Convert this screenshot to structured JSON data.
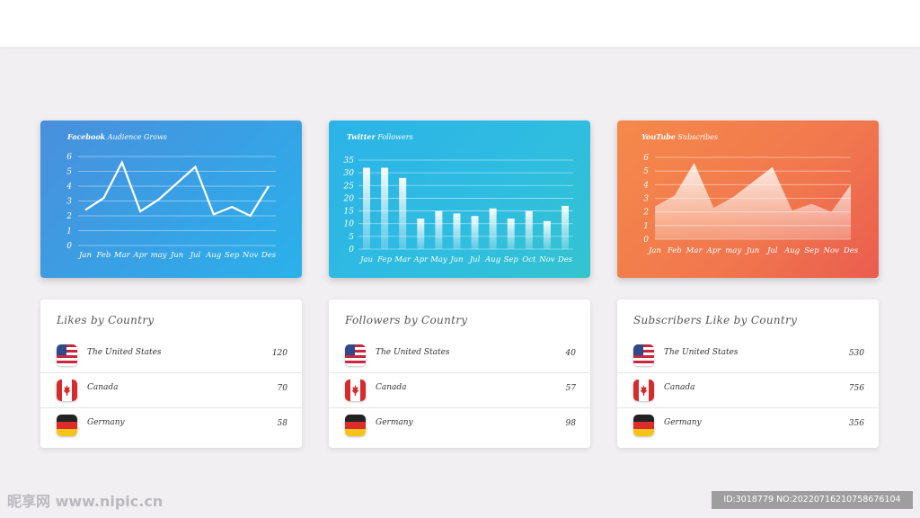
{
  "chart_data": [
    {
      "type": "line",
      "title_brand": "Facebook",
      "title_rest": " Audience Grows",
      "categories": [
        "Jan",
        "Feb",
        "Mar",
        "Apr",
        "may",
        "Jun",
        "Jul",
        "Aug",
        "Sep",
        "Nov",
        "Des"
      ],
      "values": [
        2.4,
        3.2,
        5.6,
        2.3,
        3.1,
        4.2,
        5.3,
        2.1,
        2.6,
        2.0,
        4.0
      ],
      "yticks": [
        0,
        1,
        2,
        3,
        4,
        5,
        6
      ],
      "ylim": [
        0,
        6
      ],
      "grid": true,
      "colors": {
        "line": "#ffffff"
      }
    },
    {
      "type": "bar",
      "title_brand": "Twitter",
      "title_rest": " Followers",
      "categories": [
        "Jau",
        "Fep",
        "Mar",
        "Apr",
        "May",
        "Jun",
        "Jul",
        "Aug",
        "Sep",
        "Oct",
        "Nov",
        "Des"
      ],
      "values": [
        32,
        32,
        28,
        12,
        15,
        14,
        13,
        16,
        12,
        15,
        11,
        17
      ],
      "yticks": [
        0,
        5,
        10,
        15,
        20,
        25,
        30,
        35
      ],
      "ylim": [
        0,
        35
      ],
      "grid": true,
      "colors": {
        "bar": "#ffffff"
      }
    },
    {
      "type": "area",
      "title_brand": "YouTube",
      "title_rest": " Subscribes",
      "categories": [
        "Jan",
        "Feb",
        "Mar",
        "Apr",
        "may",
        "Jun",
        "Jul",
        "Aug",
        "Sep",
        "Nov",
        "Des"
      ],
      "values": [
        2.4,
        3.2,
        5.6,
        2.3,
        3.1,
        4.2,
        5.3,
        2.1,
        2.6,
        2.0,
        4.0
      ],
      "yticks": [
        0,
        1,
        2,
        3,
        4,
        5,
        6
      ],
      "ylim": [
        0,
        6
      ],
      "grid": true,
      "colors": {
        "area": "#ffffff"
      }
    }
  ],
  "lists": [
    {
      "title": "Likes by Country",
      "rows": [
        {
          "country": "The United States",
          "value": "120",
          "flag": "us-flag"
        },
        {
          "country": "Canada",
          "value": "70",
          "flag": "canada-flag"
        },
        {
          "country": "Germany",
          "value": "58",
          "flag": "germany-flag"
        }
      ]
    },
    {
      "title": "Followers by Country",
      "rows": [
        {
          "country": "The United States",
          "value": "40",
          "flag": "us-flag"
        },
        {
          "country": "Canada",
          "value": "57",
          "flag": "canada-flag"
        },
        {
          "country": "Germany",
          "value": "98",
          "flag": "germany-flag"
        }
      ]
    },
    {
      "title": "Subscribers Like by Country",
      "rows": [
        {
          "country": "The United States",
          "value": "530",
          "flag": "us-flag"
        },
        {
          "country": "Canada",
          "value": "756",
          "flag": "canada-flag"
        },
        {
          "country": "Germany",
          "value": "356",
          "flag": "germany-flag"
        }
      ]
    }
  ],
  "watermark": {
    "left": "昵享网 www.nipic.cn",
    "right": "ID:3018779 NO:20220716210758676104"
  },
  "colors": {
    "background": "#f1eff1",
    "facebook_card": "#3f9be2",
    "twitter_card": "#2fbadf",
    "youtube_card": "#f07a4d"
  }
}
